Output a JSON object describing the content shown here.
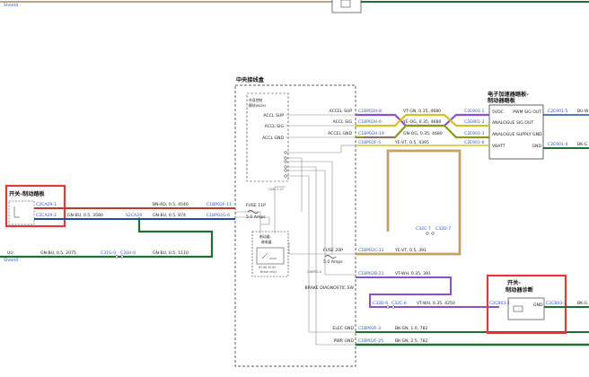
{
  "sheet_refs": {
    "top_left": "Sheet4",
    "left_mid": "Sheet4"
  },
  "modules": {
    "central": {
      "title": "中央接线盒"
    },
    "bcm": {
      "title_line1": "车身控制",
      "title_line2": "模块(BCM)"
    },
    "pedal": {
      "title_line1": "电子加速器踏板-",
      "title_line2": "制动器踏板"
    },
    "switch_left": {
      "title": "开关-制动踏板"
    },
    "switch_right": {
      "title_line1": "开关-",
      "title_line2": "制动器诊断"
    },
    "brake_relay": {
      "title_line1": "制动器-",
      "title_line2": "继电器"
    }
  },
  "bcm_pins": [
    "ACCL SUP",
    "ACCL SIG",
    "ACCL GND"
  ],
  "pedal_pins": [
    "5VDC",
    "PWM SIG OUT",
    "ANALOGUE SIG OUT",
    "ANALOGUE SUPPLY GND",
    "VBATT",
    "GND"
  ],
  "central_labels": {
    "accl_sup": "ACCEL SUP",
    "accl_sig": "ACCL SIG",
    "accl_gnd": "ACCEL GND",
    "brake_diag": "BRAKE DIAGNOSTIC SW",
    "elec_gnd": "ELEC GND",
    "pwr_gnd": "PWR GND",
    "fuse1": "FUSE 11P",
    "fuse1_rating": "5.0 Amps",
    "fuse2": "FUSE 20P",
    "fuse2_rating": "5.0 Amps",
    "relay_contact": "87 86 30 85",
    "relay_note": "Brake relay",
    "small_note1": "C2AC 1-CY",
    "small_note2": "C1BP02-8"
  },
  "wires": {
    "accel_sup": {
      "left": "C1BP02H-8",
      "spec": "VT-GN, 0.35, 4680",
      "right": "C2E901-1"
    },
    "accel_sig": {
      "left": "C1BP02H-6",
      "spec": "YE-OG, 0.35, 4680",
      "right": "C2E901-2"
    },
    "accel_gnd": {
      "left": "C1BP02H-19",
      "spec": "GN-OG, 0.35, 4680",
      "right": "C2E901-3"
    },
    "vbatt": {
      "left": "C1BP02F-5",
      "spec": "YE-VT, 0.5, 4395",
      "right": "C2E901-6"
    },
    "pedal_out1": {
      "left": "C2E901-5",
      "spec": "BU-W"
    },
    "pedal_out2": {
      "left": "C2E901-4",
      "spec": "BK-G"
    },
    "switch_red": {
      "conn": "C2CA29-1",
      "spec": "BN-RD, 0.5, 4540",
      "right": "C1BP02F-11"
    },
    "switch_blue": {
      "conn": "C2CA29-2",
      "spec": "GN-BU, 0.5, 3580",
      "mid": "S2CA29",
      "spec2": "GN-BU, 0.5, 874",
      "right": "C1BP02G-6"
    },
    "green_left": {
      "conn": "UU",
      "spec": "GN-BU, 0.5, 2075",
      "mid1": "C31G-0",
      "mid2": "C31H-0",
      "spec2": "GN-BU, 0.5, 1110"
    },
    "ye_vt": {
      "left": "C1BP02C-11",
      "spec": "YE-VT, 0.5, 391",
      "joint1": "C32C-7",
      "joint2": "C32D-7"
    },
    "vt_wh_1": {
      "left": "C1BP02B-21",
      "spec": "VT-WH, 0.35, 391"
    },
    "vt_wh_2": {
      "j1": "C32D-6",
      "j2": "C32C-6",
      "spec": "VT-WH, 0.35, 4250",
      "right": "C2CB03-1"
    },
    "elec_gnd": {
      "left": "C1BP02F-3",
      "spec": "BK-GN, 1.0, 782"
    },
    "pwr_gnd": {
      "left": "C1BP02F-25",
      "spec": "BK-GN, 2.5, 782"
    },
    "switch_right_out": {
      "left": "C2CB03-2",
      "spec": "BK-G"
    }
  },
  "switch_right_pin": "GND",
  "colors": {
    "highlight": "#e03a3a",
    "wire_red": "#c0392b",
    "wire_blue": "#1f4e9e",
    "wire_green": "#1f6e32",
    "wire_violet": "#8c4fd0",
    "wire_yellow": "#d3c125",
    "wire_olive": "#8a9a1c",
    "wire_brown": "#9c6b30",
    "wire_gray": "#8a8a8a",
    "wire_black": "#222222",
    "ref_blue": "#2b57c9"
  }
}
